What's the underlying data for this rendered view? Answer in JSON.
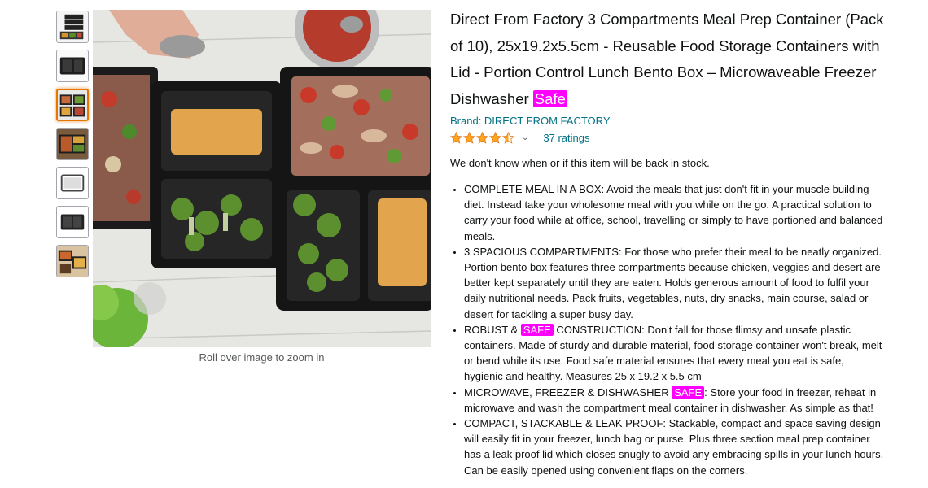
{
  "gallery": {
    "thumbnails": [
      {
        "icon": "stacked-containers-thumbnail"
      },
      {
        "icon": "two-compartment-thumbnail"
      },
      {
        "icon": "meal-prep-thumbnail",
        "selected": true
      },
      {
        "icon": "food-tray-thumbnail"
      },
      {
        "icon": "lid-thumbnail"
      },
      {
        "icon": "empty-container-thumbnail"
      },
      {
        "icon": "kitchen-scene-thumbnail"
      }
    ],
    "zoom_hint": "Roll over image to zoom in"
  },
  "product": {
    "title_parts": {
      "main": "Direct From Factory 3 Compartments Meal Prep Container (Pack of 10), 25x19.2x5.5cm - Reusable Food Storage Containers with Lid - Portion Control Lunch Bento Box – Microwaveable Freezer Dishwasher ",
      "highlight": "Safe"
    },
    "brand": "Brand: DIRECT FROM FACTORY",
    "rating": {
      "stars": 4.5,
      "chevron": "⌄",
      "count_label": "37 ratings"
    },
    "availability": "We don't know when or if this item will be back in stock.",
    "bullets": [
      {
        "pre": "COMPLETE MEAL IN A BOX: Avoid the meals that just don't fit in your muscle building diet. Instead take your wholesome meal with you while on the go. A practical solution to carry your food while at office, school, travelling or simply to have portioned and balanced meals.",
        "highlight": "",
        "post": ""
      },
      {
        "pre": "3 SPACIOUS COMPARTMENTS: For those who prefer their meal to be neatly organized. Portion bento box features three compartments because chicken, veggies and desert are better kept separately until they are eaten. Holds generous amount of food to fulfil your daily nutritional needs. Pack fruits, vegetables, nuts, dry snacks, main course, salad or desert for tackling a super busy day.",
        "highlight": "",
        "post": ""
      },
      {
        "pre": "ROBUST & ",
        "highlight": "SAFE",
        "post": " CONSTRUCTION: Don't fall for those flimsy and unsafe plastic containers. Made of sturdy and durable material, food storage container won't break, melt or bend while its use. Food safe material ensures that every meal you eat is safe, hygienic and healthy. Measures 25 x 19.2 x 5.5 cm"
      },
      {
        "pre": "MICROWAVE, FREEZER & DISHWASHER ",
        "highlight": "SAFE",
        "post": ": Store your food in freezer, reheat in microwave and wash the compartment meal container in dishwasher. As simple as that!"
      },
      {
        "pre": "COMPACT, STACKABLE & LEAK PROOF: Stackable, compact and space saving design will easily fit in your freezer, lunch bag or purse. Plus three section meal prep container has a leak proof lid which closes snugly to avoid any embracing spills in your lunch hours. Can be easily opened using convenient flaps on the corners.",
        "highlight": "",
        "post": ""
      }
    ]
  },
  "colors": {
    "link": "#007185",
    "star": "#ffa41c",
    "highlight_bg": "#ff00ff",
    "thumb_selected": "#e77600"
  }
}
